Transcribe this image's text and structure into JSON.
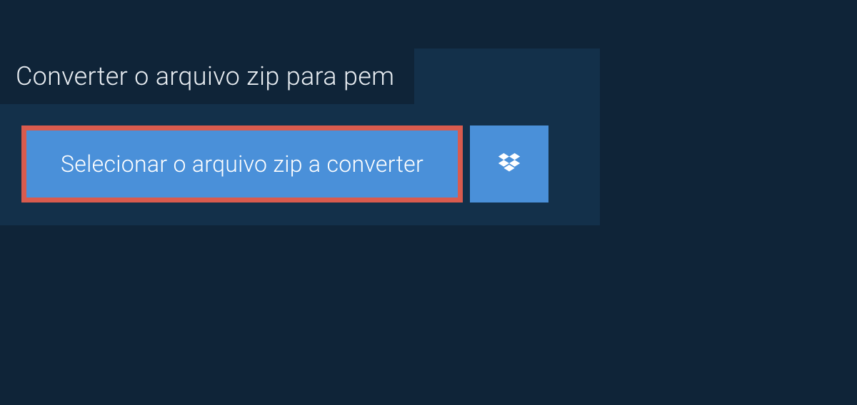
{
  "title": "Converter o arquivo zip para pem",
  "selectButton": {
    "label": "Selecionar o arquivo zip a converter"
  },
  "colors": {
    "background": "#0f2438",
    "panel": "#13304a",
    "buttonBg": "#4a90d9",
    "highlightBorder": "#d95b4e",
    "text": "#e8edf2"
  }
}
